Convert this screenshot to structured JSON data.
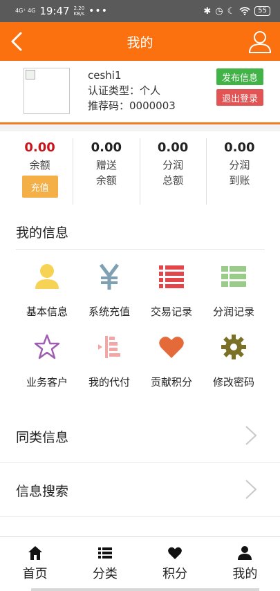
{
  "status_bar": {
    "network": "4G⁺ 4G",
    "time": "19:47",
    "speed_value": "2.20",
    "speed_unit": "KB/s",
    "more": "•••",
    "battery": "55"
  },
  "header": {
    "title": "我的",
    "back_icon": "chevron-left-icon",
    "user_icon": "user-icon"
  },
  "profile": {
    "username": "ceshi1",
    "auth_type": "认证类型：个人",
    "referral_code": "推荐码：0000003",
    "publish_label": "发布信息",
    "logout_label": "退出登录"
  },
  "stats": [
    {
      "value": "0.00",
      "line1": "余额",
      "line2": "",
      "button": "充值",
      "highlight": true
    },
    {
      "value": "0.00",
      "line1": "赠送",
      "line2": "余额"
    },
    {
      "value": "0.00",
      "line1": "分润",
      "line2": "总额"
    },
    {
      "value": "0.00",
      "line1": "分润",
      "line2": "到账"
    }
  ],
  "my_info": {
    "title": "我的信息",
    "items": [
      {
        "label": "基本信息",
        "icon": "user-icon",
        "color": "#f6d255"
      },
      {
        "label": "系统充值",
        "icon": "yen-icon",
        "color": "#7fa0b3"
      },
      {
        "label": "交易记录",
        "icon": "list-icon",
        "color": "#e2464a"
      },
      {
        "label": "分润记录",
        "icon": "list-alt-icon",
        "color": "#99cc88"
      },
      {
        "label": "业务客户",
        "icon": "star-icon",
        "color": "#9e5fb2"
      },
      {
        "label": "我的代付",
        "icon": "indent-icon",
        "color": "#f1a7a6"
      },
      {
        "label": "贡献积分",
        "icon": "heart-icon",
        "color": "#e46a3a"
      },
      {
        "label": "修改密码",
        "icon": "gear-icon",
        "color": "#7a7126"
      }
    ]
  },
  "list": [
    {
      "label": "同类信息"
    },
    {
      "label": "信息搜索"
    }
  ],
  "tabs": [
    {
      "label": "首页",
      "icon": "home-icon"
    },
    {
      "label": "分类",
      "icon": "list-icon"
    },
    {
      "label": "积分",
      "icon": "heart-icon"
    },
    {
      "label": "我的",
      "icon": "user-icon"
    }
  ]
}
